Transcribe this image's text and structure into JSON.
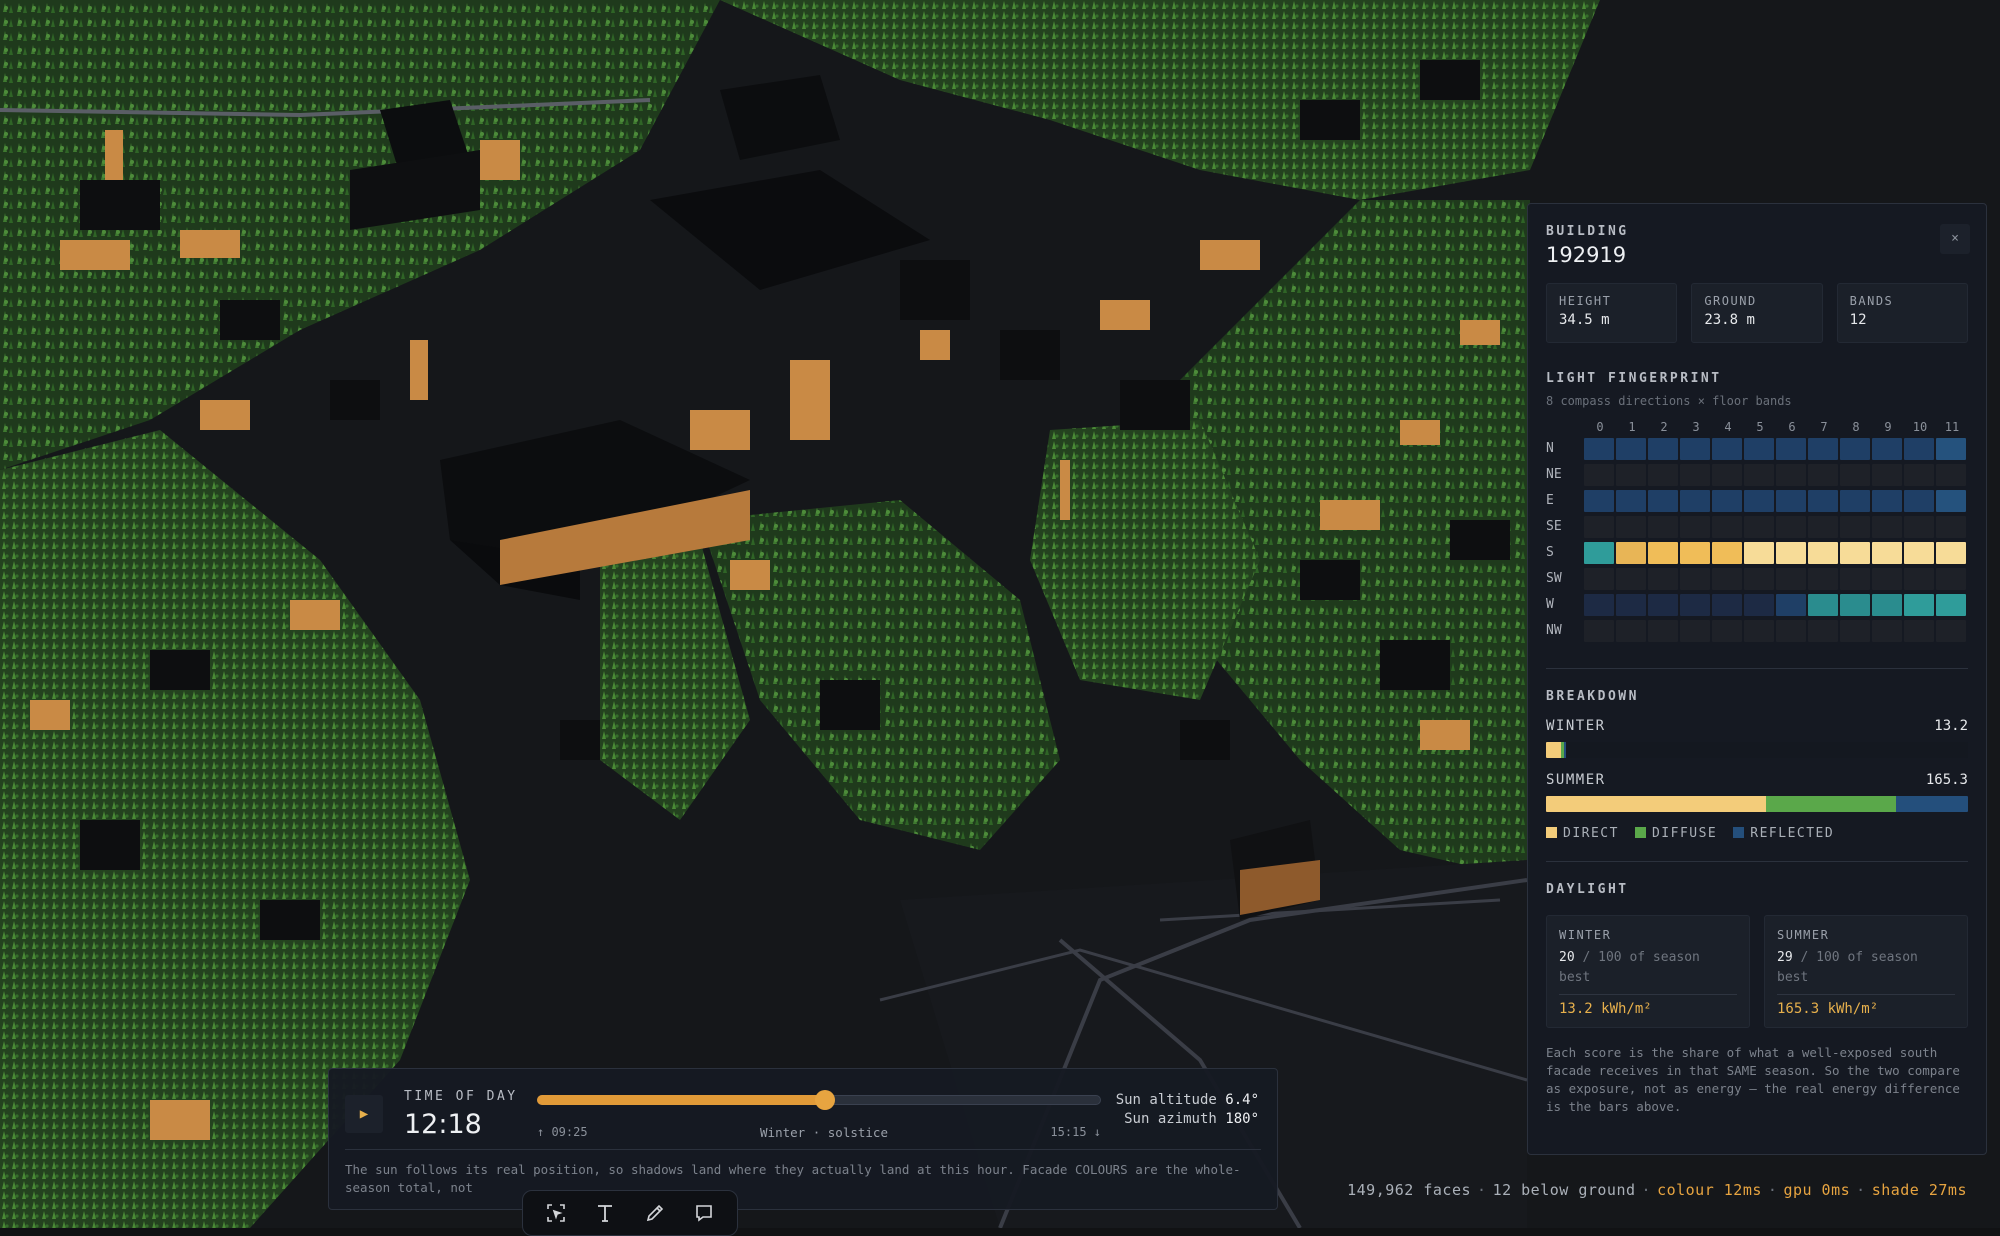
{
  "building": {
    "section_label": "BUILDING",
    "id": "192919",
    "close_label": "×",
    "stats": [
      {
        "label": "HEIGHT",
        "value": "34.5 m"
      },
      {
        "label": "GROUND",
        "value": "23.8 m"
      },
      {
        "label": "BANDS",
        "value": "12"
      }
    ]
  },
  "fingerprint": {
    "title": "LIGHT FINGERPRINT",
    "subtitle": "8 compass directions × floor bands",
    "bands": [
      "0",
      "1",
      "2",
      "3",
      "4",
      "5",
      "6",
      "7",
      "8",
      "9",
      "10",
      "11"
    ],
    "directions": [
      "N",
      "NE",
      "E",
      "SE",
      "S",
      "SW",
      "W",
      "NW"
    ],
    "levels": [
      [
        2,
        2,
        2,
        2,
        2,
        2,
        2,
        2,
        2,
        2,
        2,
        3
      ],
      [
        0,
        0,
        0,
        0,
        0,
        0,
        0,
        0,
        0,
        0,
        0,
        0
      ],
      [
        2,
        2,
        2,
        2,
        2,
        2,
        2,
        2,
        2,
        2,
        2,
        3
      ],
      [
        0,
        0,
        0,
        0,
        0,
        0,
        0,
        0,
        0,
        0,
        0,
        0
      ],
      [
        5,
        6,
        7,
        7,
        7,
        8,
        8,
        8,
        8,
        8,
        8,
        8
      ],
      [
        0,
        0,
        0,
        0,
        0,
        0,
        0,
        0,
        0,
        0,
        0,
        0
      ],
      [
        1,
        1,
        1,
        1,
        1,
        1,
        2,
        4,
        4,
        4,
        5,
        5
      ],
      [
        0,
        0,
        0,
        0,
        0,
        0,
        0,
        0,
        0,
        0,
        0,
        0
      ]
    ],
    "palette": [
      "#1e2128",
      "#1d2a44",
      "#1f3f66",
      "#25527d",
      "#2a8c8e",
      "#2f9c9a",
      "#e8b556",
      "#f0bd58",
      "#f7dc98"
    ]
  },
  "breakdown": {
    "title": "BREAKDOWN",
    "seasons": [
      {
        "label": "WINTER",
        "value": "13.2",
        "total": 13.2,
        "direct": 6.0,
        "diffuse": 1.0,
        "reflected": 0.8
      },
      {
        "label": "SUMMER",
        "value": "165.3",
        "total": 165.3,
        "direct": 86.0,
        "diffuse": 51.0,
        "reflected": 28.3
      }
    ],
    "scale_max": 165.3,
    "colors": {
      "direct": "#f3cc7a",
      "diffuse": "#5aa84a",
      "reflected": "#244f7c"
    },
    "legend": [
      "DIRECT",
      "DIFFUSE",
      "REFLECTED"
    ]
  },
  "daylight": {
    "title": "DAYLIGHT",
    "cards": [
      {
        "label": "WINTER",
        "score": "20",
        "suffix": "/ 100 of season best",
        "energy": "13.2 kWh/m²"
      },
      {
        "label": "SUMMER",
        "score": "29",
        "suffix": "/ 100 of season best",
        "energy": "165.3 kWh/m²"
      }
    ],
    "note": "Each score is the share of what a well-exposed south facade receives in that SAME season. So the two compare as exposure, not as energy — the real energy difference is the bars above."
  },
  "time_of_day": {
    "label": "TIME OF DAY",
    "time": "12:18",
    "play_icon": "▶",
    "sunrise": "↑ 09:25",
    "season": "Winter · solstice",
    "sunset": "15:15 ↓",
    "slider_fraction": 0.51,
    "sun_altitude_label": "Sun altitude",
    "sun_altitude": "6.4°",
    "sun_azimuth_label": "Sun azimuth",
    "sun_azimuth": "180°",
    "note": "The sun follows its real position, so shadows land where they actually land at this hour. Facade COLOURS are the whole-season total, not"
  },
  "toolbar": {
    "tools": [
      "select-icon",
      "text-icon",
      "pen-icon",
      "comment-icon"
    ]
  },
  "status": {
    "faces": "149,962 faces",
    "below": "12 below ground",
    "colour": "colour 12ms",
    "gpu": "gpu 0ms",
    "shade": "shade 27ms"
  }
}
